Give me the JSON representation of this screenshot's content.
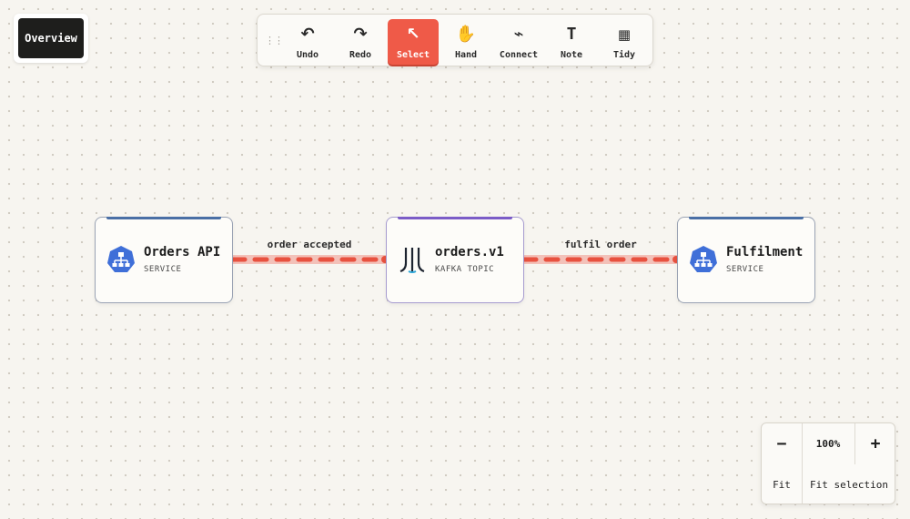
{
  "overview": {
    "label": "Overview"
  },
  "toolbar": {
    "tools": [
      {
        "label": "Undo",
        "icon": "undo-icon",
        "glyph": "↶"
      },
      {
        "label": "Redo",
        "icon": "redo-icon",
        "glyph": "↷"
      },
      {
        "label": "Select",
        "icon": "cursor-icon",
        "glyph": "↖",
        "active": true
      },
      {
        "label": "Hand",
        "icon": "hand-icon",
        "glyph": "✋"
      },
      {
        "label": "Connect",
        "icon": "connect-icon",
        "glyph": "⌁"
      },
      {
        "label": "Note",
        "icon": "text-icon",
        "glyph": "T"
      },
      {
        "label": "Tidy",
        "icon": "grid-icon",
        "glyph": "▦"
      }
    ]
  },
  "nodes": [
    {
      "title": "Orders API",
      "type": "SERVICE",
      "icon": "service-icon",
      "accent": "#4a6fa5"
    },
    {
      "title": "orders.v1",
      "type": "KAFKA TOPIC",
      "icon": "kafka-icon",
      "accent": "#7b5cc7"
    },
    {
      "title": "Fulfilment",
      "type": "SERVICE",
      "icon": "service-icon",
      "accent": "#4a6fa5"
    }
  ],
  "edges": [
    {
      "label": "order accepted",
      "from": "Orders API",
      "to": "orders.v1"
    },
    {
      "label": "fulfil order",
      "from": "orders.v1",
      "to": "Fulfilment"
    }
  ],
  "zoom": {
    "minus": "−",
    "level": "100%",
    "plus": "+",
    "fit": "Fit",
    "fit_selection": "Fit selection"
  },
  "colors": {
    "edge": "#e8513f",
    "edge_glow": "#f2b3aa",
    "service": "#3f6fd8",
    "kafka": "#1d2430",
    "kafka_accent": "#29a3d6",
    "active_tool": "#ef5a48"
  }
}
